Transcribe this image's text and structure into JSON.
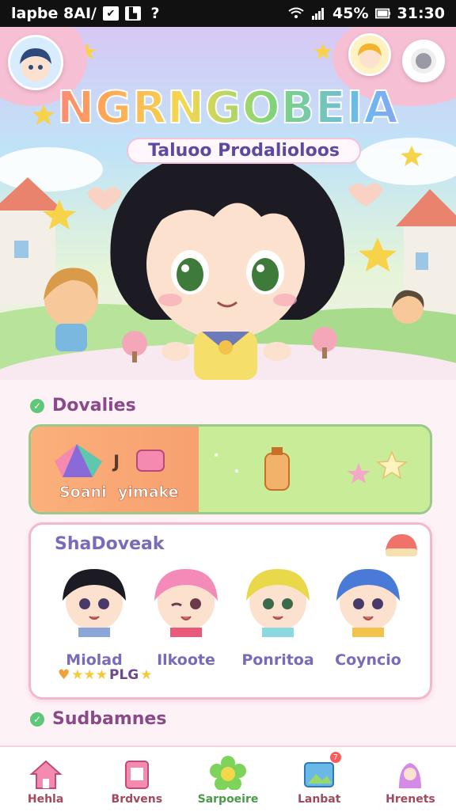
{
  "status_bar": {
    "carrier": "lapbe 8AI/",
    "battery_percent": "45%",
    "time": "31:30"
  },
  "hero": {
    "title": "NGRNGOBEIA",
    "subtitle": "Taluoo Prodalioloos"
  },
  "sections": {
    "first": {
      "title": "Dovalies",
      "items": [
        {
          "label": "Soani"
        },
        {
          "label": "yimake"
        }
      ]
    },
    "characters": {
      "title": "ShaDoveak",
      "list": [
        {
          "name": "Miolad"
        },
        {
          "name": "Ilkoote"
        },
        {
          "name": "Ponritoa"
        },
        {
          "name": "Coyncio"
        }
      ],
      "rating_text": "PLG"
    },
    "second": {
      "title": "Sudbamnes"
    }
  },
  "nav": [
    {
      "label": "Hehla"
    },
    {
      "label": "Brdvens"
    },
    {
      "label": "Sarpoeire"
    },
    {
      "label": "Lanbat",
      "badge": "7"
    },
    {
      "label": "Hrenets"
    }
  ],
  "colors": {
    "accent_pink": "#f3b8cf",
    "accent_green": "#9cc88c",
    "text_purple": "#7a6ab8"
  }
}
